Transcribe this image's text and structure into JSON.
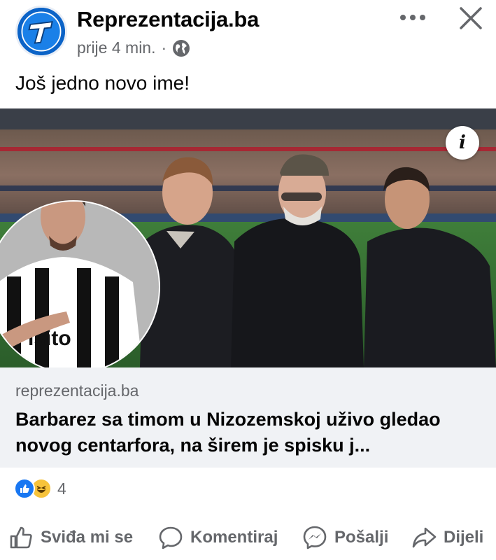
{
  "post": {
    "page_name": "Reprezentacija.ba",
    "time": "prije 4 min.",
    "separator": "·",
    "text": "Još jedno novo ime!"
  },
  "link_preview": {
    "domain": "reprezentacija.ba",
    "title": "Barbarez sa timom u Nizozemskoj uživo gledao novog centarfora, na širem je spisku j...",
    "image_shirt_text": "isito"
  },
  "reactions": {
    "types": [
      "like",
      "haha"
    ],
    "count": "4"
  },
  "actions": {
    "like_label": "Sviđa mi se",
    "comment_label": "Komentiraj",
    "send_label": "Pošalji",
    "share_label": "Dijeli"
  },
  "icons": {
    "avatar": "reprezentacija-logo",
    "globe": "globe-icon",
    "more": "more-options-icon",
    "close": "close-icon",
    "info": "info-icon",
    "like": "thumbs-up-icon",
    "comment": "speech-bubble-icon",
    "send": "messenger-icon",
    "share": "share-arrow-icon"
  },
  "colors": {
    "brand_blue": "#1877f2",
    "secondary_text": "#65676b",
    "link_box_bg": "#f0f2f5",
    "logo_blue": "#0b63c7"
  }
}
